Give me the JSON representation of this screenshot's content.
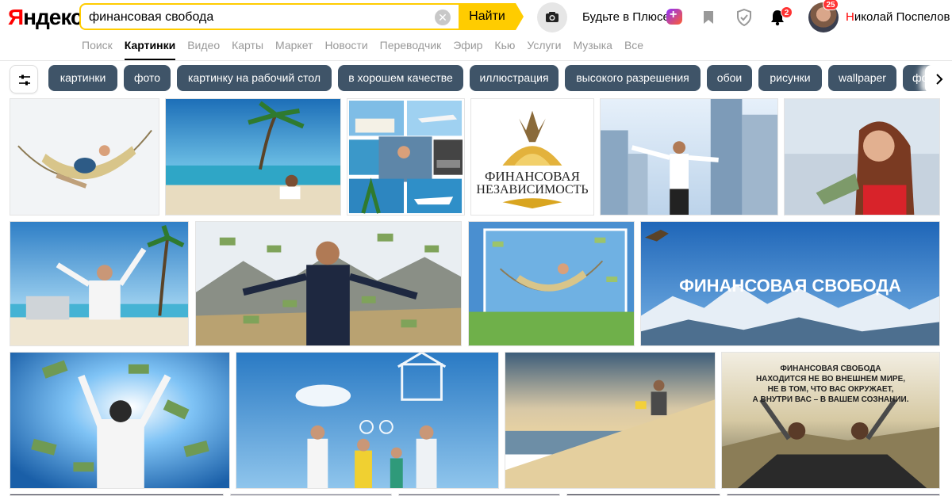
{
  "logo": {
    "first_letter": "Я",
    "rest": "ндекс"
  },
  "search": {
    "value": "финансовая свобода",
    "button_label": "Найти"
  },
  "header": {
    "plus_label": "Будьте в Плюсе",
    "notifications_count": "2",
    "profile_badge": "25",
    "user_first_letter": "Н",
    "user_name_rest": "иколай Поспелов"
  },
  "nav": {
    "items": [
      "Поиск",
      "Картинки",
      "Видео",
      "Карты",
      "Маркет",
      "Новости",
      "Переводчик",
      "Эфир",
      "Кью",
      "Услуги",
      "Музыка",
      "Все"
    ],
    "active": "Картинки"
  },
  "chips": [
    "картинки",
    "фото",
    "картинку на рабочий стол",
    "в хорошем качестве",
    "иллюстрация",
    "высокого разрешения",
    "обои",
    "рисунки",
    "wallpaper",
    "фо"
  ],
  "images": {
    "img4_line1": "ФИНАНСОВАЯ",
    "img4_line2": "НЕЗАВИСИМОСТЬ",
    "img10_text": "ФИНАНСОВАЯ СВОБОДА",
    "img14_text": [
      "ФИНАНСОВАЯ СВОБОДА",
      "НАХОДИТСЯ НЕ ВО ВНЕШНЕМ МИРЕ,",
      "НЕ В ТОМ, ЧТО ВАС ОКРУЖАЕТ,",
      "А ВНУТРИ ВАС – В ВАШЕМ СОЗНАНИИ."
    ]
  },
  "colors": {
    "search_yellow": "#ffcc00",
    "chip_bg": "#3f5468",
    "badge_red": "#ff3333"
  }
}
